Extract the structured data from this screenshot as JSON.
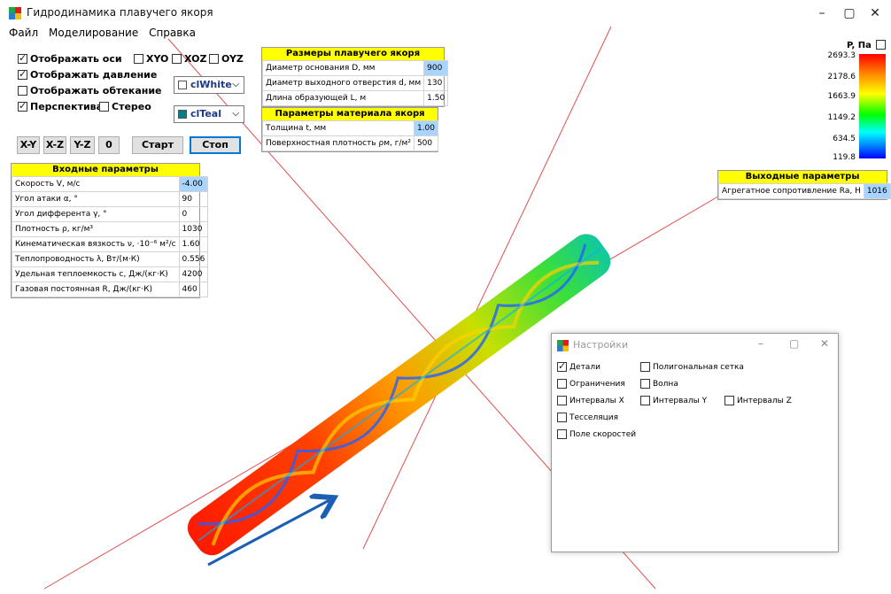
{
  "window": {
    "title": "Гидродинамика плавучего якоря",
    "minimize": "–",
    "maximize": "▢",
    "close": "✕"
  },
  "menu": [
    "Файл",
    "Моделирование",
    "Справка"
  ],
  "options": {
    "show_axes": "Отображать оси",
    "show_pressure": "Отображать давление",
    "show_flow": "Отображать обтекание",
    "perspective": "Перспектива",
    "stereo": "Стерео",
    "xyo": "XYO",
    "xoz": "XOZ",
    "oyz": "OYZ"
  },
  "combos": {
    "background": "clWhite",
    "object": "clTeal",
    "object_color": "#008080"
  },
  "buttons": [
    "X-Y",
    "X-Z",
    "Y-Z",
    "0",
    "Старт",
    "Стоп"
  ],
  "anchor_size": {
    "title": "Размеры плавучего якоря",
    "rows": [
      {
        "label": "Диаметр основания D, мм",
        "value": "900"
      },
      {
        "label": "Диаметр выходного отверстия d, мм",
        "value": "130"
      },
      {
        "label": "Длина образующей L, м",
        "value": "1.50"
      }
    ]
  },
  "material": {
    "title": "Параметры материала якоря",
    "rows": [
      {
        "label": "Толщина t, мм",
        "value": "1.00"
      },
      {
        "label": "Поверхностная плотность ρм, г/м²",
        "value": "500"
      }
    ]
  },
  "inputs": {
    "title": "Входные параметры",
    "rows": [
      {
        "label": "Скорость V, м/с",
        "value": "-4.00"
      },
      {
        "label": "Угол атаки α, °",
        "value": "90"
      },
      {
        "label": "Угол дифферента γ, °",
        "value": "0"
      },
      {
        "label": "Плотность ρ, кг/м³",
        "value": "1030"
      },
      {
        "label": "Кинематическая вязкость ν, ·10⁻⁶ м²/с",
        "value": "1.60"
      },
      {
        "label": "Теплопроводность λ, Вт/(м·К)",
        "value": "0.556"
      },
      {
        "label": "Удельная теплоемкость c, Дж/(кг·К)",
        "value": "4200"
      },
      {
        "label": "Газовая постоянная R, Дж/(кг·К)",
        "value": "460"
      }
    ]
  },
  "outputs": {
    "title": "Выходные параметры",
    "rows": [
      {
        "label": "Агрегатное сопротивление Ra, Н",
        "value": "1016"
      }
    ]
  },
  "scale": {
    "unit": "P, Па",
    "ticks": [
      "2693.3",
      "2178.6",
      "1663.9",
      "1149.2",
      "634.5",
      "119.8"
    ]
  },
  "settings": {
    "title": "Настройки",
    "items": [
      {
        "label": "Детали",
        "checked": true
      },
      {
        "label": "Полигональная сетка",
        "checked": false
      },
      {
        "label": "Ограничения",
        "checked": false
      },
      {
        "label": "Волна",
        "checked": false
      },
      {
        "label": "Интервалы X",
        "checked": false
      },
      {
        "label": "Интервалы Y",
        "checked": false
      },
      {
        "label": "Интервалы Z",
        "checked": false
      },
      {
        "label": "Тесселяция",
        "checked": false
      },
      {
        "label": "Поле скоростей",
        "checked": false
      }
    ]
  },
  "colors": {
    "axis_line": "#e05050",
    "highlight": "#ffff00",
    "selected_cell": "#a8d4ff",
    "arrow": "#1a5fb4"
  }
}
